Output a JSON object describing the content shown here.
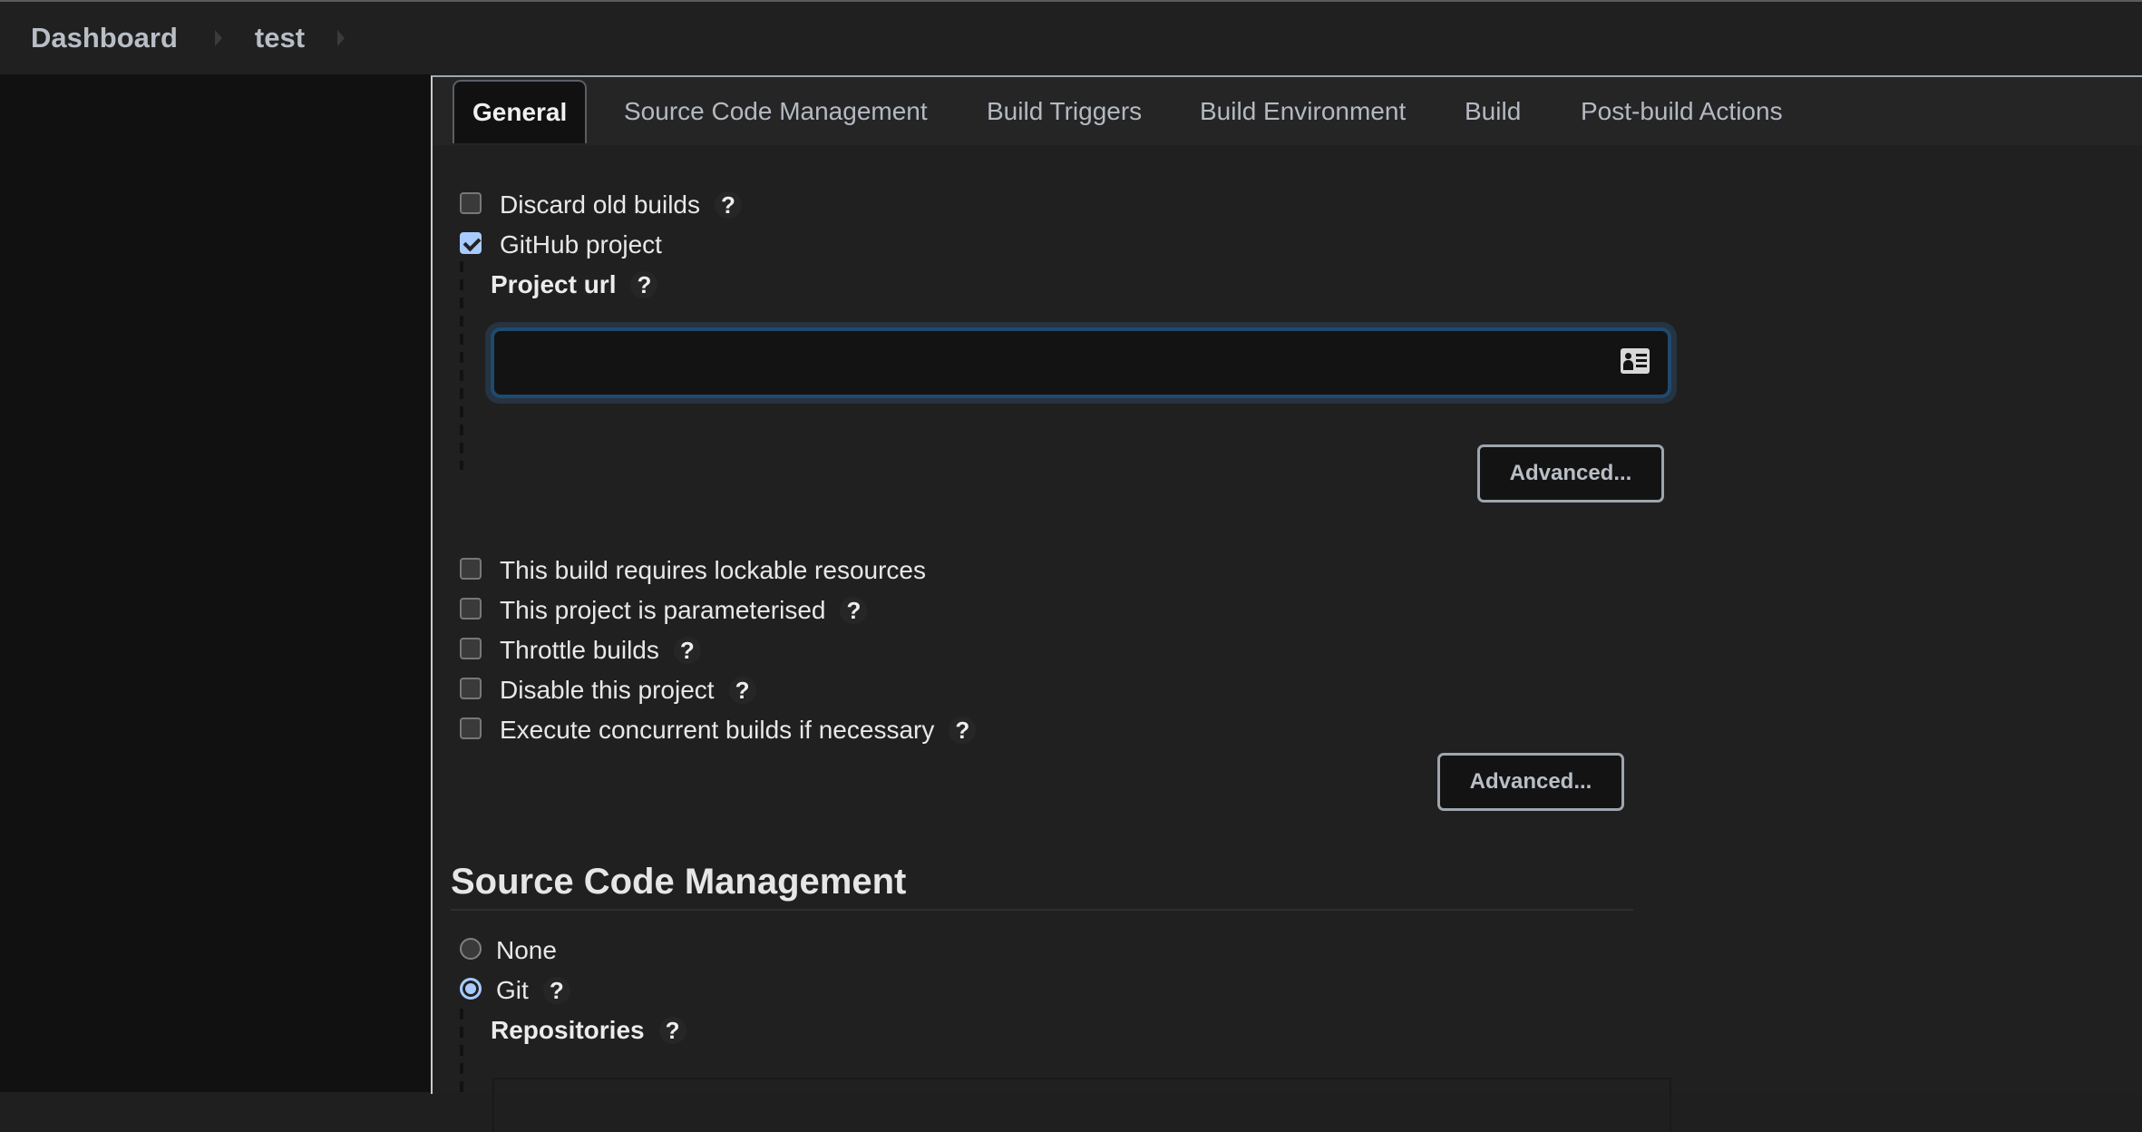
{
  "breadcrumb": {
    "items": [
      {
        "label": "Dashboard"
      },
      {
        "label": "test"
      }
    ]
  },
  "tabs": [
    {
      "label": "General",
      "active": true
    },
    {
      "label": "Source Code Management",
      "active": false
    },
    {
      "label": "Build Triggers",
      "active": false
    },
    {
      "label": "Build Environment",
      "active": false
    },
    {
      "label": "Build",
      "active": false
    },
    {
      "label": "Post-build Actions",
      "active": false
    }
  ],
  "general": {
    "discard_old_builds": {
      "label": "Discard old builds",
      "checked": false
    },
    "github_project": {
      "label": "GitHub project",
      "checked": true
    },
    "project_url": {
      "label": "Project url",
      "value": "",
      "icon": "contact-card-icon"
    },
    "advanced_label": "Advanced...",
    "options": [
      {
        "label": "This build requires lockable resources",
        "checked": false,
        "help": false
      },
      {
        "label": "This project is parameterised",
        "checked": false,
        "help": true
      },
      {
        "label": "Throttle builds",
        "checked": false,
        "help": true
      },
      {
        "label": "Disable this project",
        "checked": false,
        "help": true
      },
      {
        "label": "Execute concurrent builds if necessary",
        "checked": false,
        "help": true
      }
    ],
    "advanced2_label": "Advanced..."
  },
  "scm": {
    "title": "Source Code Management",
    "options": [
      {
        "label": "None",
        "selected": false
      },
      {
        "label": "Git",
        "selected": true
      }
    ],
    "repositories_label": "Repositories"
  },
  "help_glyph": "?"
}
